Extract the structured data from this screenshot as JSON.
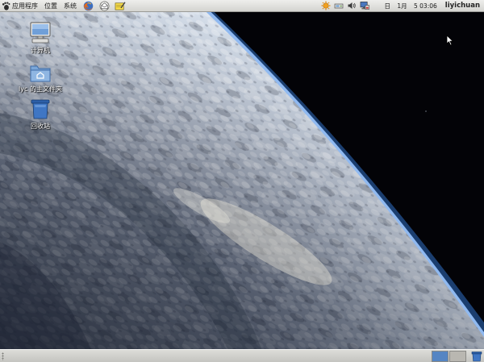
{
  "top_panel": {
    "menus": [
      {
        "label": "应用程序",
        "icon": "gnome-foot-icon"
      },
      {
        "label": "位置"
      },
      {
        "label": "系统"
      }
    ],
    "launchers": [
      "firefox-icon",
      "evolution-mail-icon",
      "text-editor-icon"
    ],
    "tray_icons": [
      "update-notifier-icon",
      "network-icon",
      "volume-icon",
      "network-monitor-icon"
    ],
    "clock": {
      "day": "日",
      "month": "1月",
      "time": "5 03:06"
    },
    "username": "liyichuan"
  },
  "desktop_icons": [
    {
      "label": "计算机",
      "icon": "computer-icon"
    },
    {
      "label": "lyc 的主文件夹",
      "icon": "home-folder-icon"
    },
    {
      "label": "回收站",
      "icon": "trash-icon"
    }
  ],
  "bottom_panel": {
    "workspaces": [
      {
        "name": "workspace-1",
        "active": true,
        "color": "#5585c3"
      },
      {
        "name": "workspace-2",
        "active": false,
        "color": "#b9b7b1"
      }
    ],
    "applets": [
      "trash-icon"
    ]
  },
  "colors": {
    "panel": "#dcdcd8",
    "accent": "#5585c3",
    "atmosphere": "#4f8fd6"
  }
}
